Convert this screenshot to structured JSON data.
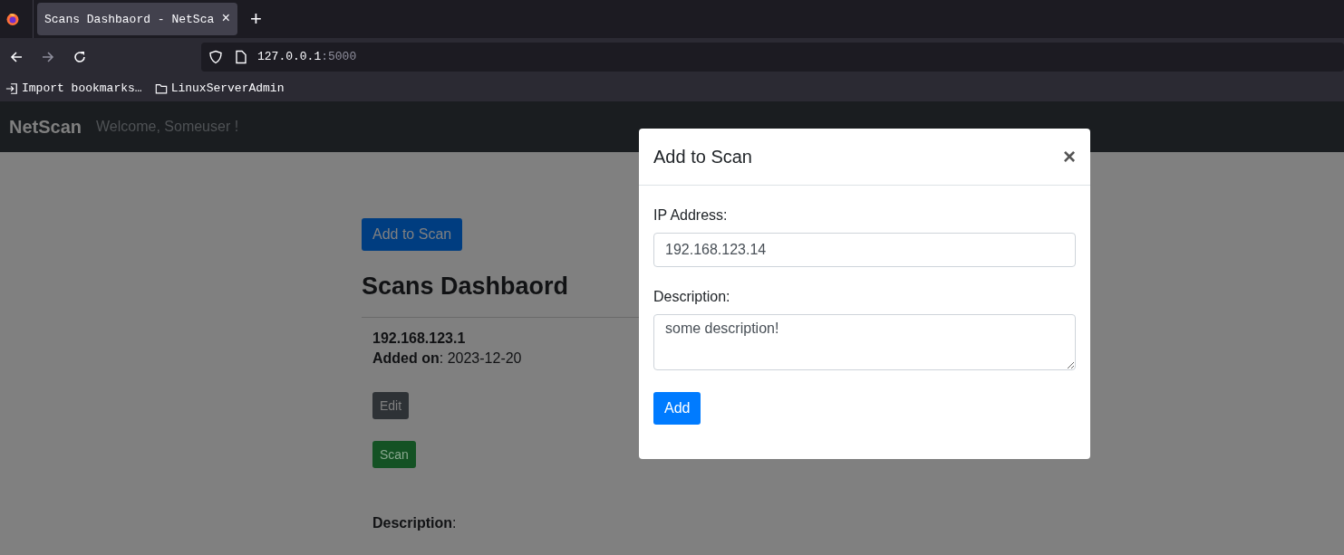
{
  "browser": {
    "tab": {
      "title": "Scans Dashbaord - NetSca",
      "close": "×"
    },
    "new_tab": "+",
    "url": {
      "host": "127.0.0.1",
      "port": ":5000"
    },
    "bookmarks": [
      {
        "kind": "import",
        "label": "Import bookmarks…"
      },
      {
        "kind": "folder",
        "label": "LinuxServerAdmin"
      }
    ]
  },
  "navbar": {
    "brand": "NetScan",
    "welcome": "Welcome, Someuser !"
  },
  "page": {
    "add_button": "Add to Scan",
    "heading": "Scans Dashbaord",
    "scans": [
      {
        "ip": "192.168.123.1",
        "added_label": "Added on",
        "added_sep": ":",
        "added_on": "2023-12-20",
        "edit": "Edit",
        "scan": "Scan",
        "description_label": "Description",
        "description_sep": ":"
      }
    ]
  },
  "modal": {
    "title": "Add to Scan",
    "close": "×",
    "fields": [
      {
        "kind": "input",
        "label": "IP Address:",
        "value": "192.168.123.14"
      },
      {
        "kind": "textarea",
        "label": "Description:",
        "value": "some description!"
      }
    ],
    "submit": "Add"
  }
}
